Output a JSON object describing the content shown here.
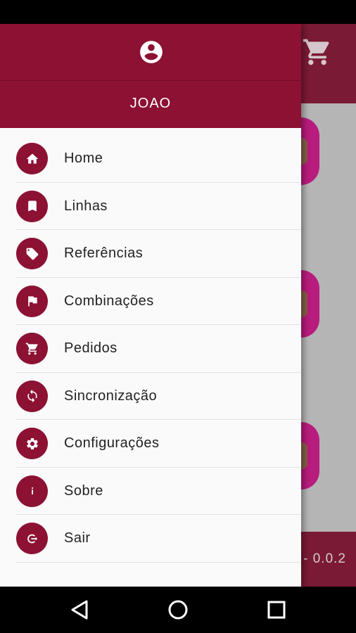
{
  "drawer": {
    "user_name": "JOAO",
    "items": [
      {
        "label": "Home",
        "icon": "home-icon"
      },
      {
        "label": "Linhas",
        "icon": "bookmark-icon"
      },
      {
        "label": "Referências",
        "icon": "tag-icon"
      },
      {
        "label": "Combinações",
        "icon": "flag-icon"
      },
      {
        "label": "Pedidos",
        "icon": "cart-icon"
      },
      {
        "label": "Sincronização",
        "icon": "sync-icon"
      },
      {
        "label": "Configurações",
        "icon": "gear-icon"
      },
      {
        "label": "Sobre",
        "icon": "info-icon"
      },
      {
        "label": "Sair",
        "icon": "logout-icon"
      }
    ]
  },
  "app": {
    "version_text": "- 0.0.2"
  },
  "colors": {
    "primary": "#8c1133",
    "toolbar": "#8c1e3c",
    "accent_pink": "#d2208f"
  }
}
